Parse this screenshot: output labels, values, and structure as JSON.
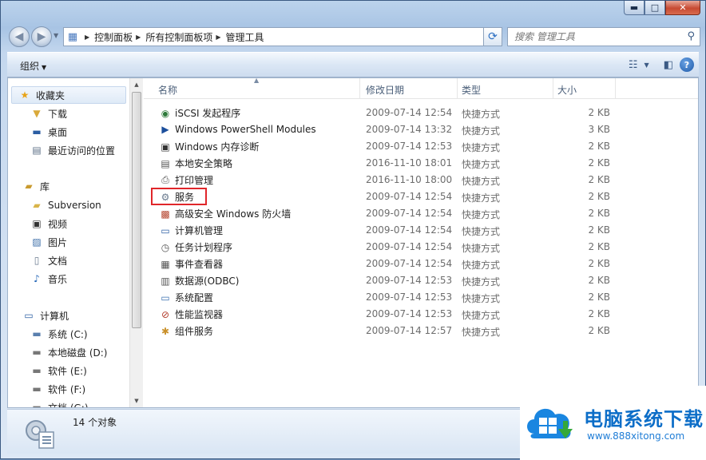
{
  "window": {
    "caption": {
      "minimize": "▬",
      "maximize": "□",
      "close": "✕"
    }
  },
  "addressbar": {
    "breadcrumbs": [
      "控制面板",
      "所有控制面板项",
      "管理工具"
    ]
  },
  "search": {
    "placeholder": "搜索 管理工具"
  },
  "toolbar": {
    "organize_label": "组织"
  },
  "nav": {
    "items": [
      {
        "label": "收藏夹",
        "icon": "star-icon"
      },
      {
        "label": "下载",
        "icon": "download-folder-icon"
      },
      {
        "label": "桌面",
        "icon": "desktop-icon"
      },
      {
        "label": "最近访问的位置",
        "icon": "recent-places-icon"
      },
      {
        "label": "库",
        "icon": "library-icon"
      },
      {
        "label": "Subversion",
        "icon": "folder-icon"
      },
      {
        "label": "视频",
        "icon": "video-icon"
      },
      {
        "label": "图片",
        "icon": "picture-icon"
      },
      {
        "label": "文档",
        "icon": "document-icon"
      },
      {
        "label": "音乐",
        "icon": "music-icon"
      },
      {
        "label": "计算机",
        "icon": "computer-icon"
      },
      {
        "label": "系统 (C:)",
        "icon": "system-drive-icon"
      },
      {
        "label": "本地磁盘 (D:)",
        "icon": "drive-icon"
      },
      {
        "label": "软件 (E:)",
        "icon": "drive-icon"
      },
      {
        "label": "软件 (F:)",
        "icon": "drive-icon"
      },
      {
        "label": "文档 (G:)",
        "icon": "drive-icon"
      }
    ]
  },
  "columns": {
    "name": "名称",
    "date": "修改日期",
    "type": "类型",
    "size": "大小"
  },
  "files": [
    {
      "name": "iSCSI 发起程序",
      "date": "2009-07-14 12:54",
      "type": "快捷方式",
      "size": "2 KB",
      "icon": "iscsi-icon"
    },
    {
      "name": "Windows PowerShell Modules",
      "date": "2009-07-14 13:32",
      "type": "快捷方式",
      "size": "3 KB",
      "icon": "powershell-icon"
    },
    {
      "name": "Windows 内存诊断",
      "date": "2009-07-14 12:53",
      "type": "快捷方式",
      "size": "2 KB",
      "icon": "memory-diagnostic-icon"
    },
    {
      "name": "本地安全策略",
      "date": "2016-11-10 18:01",
      "type": "快捷方式",
      "size": "2 KB",
      "icon": "security-policy-icon"
    },
    {
      "name": "打印管理",
      "date": "2016-11-10 18:00",
      "type": "快捷方式",
      "size": "2 KB",
      "icon": "print-management-icon"
    },
    {
      "name": "服务",
      "date": "2009-07-14 12:54",
      "type": "快捷方式",
      "size": "2 KB",
      "icon": "services-gear-icon"
    },
    {
      "name": "高级安全 Windows 防火墙",
      "date": "2009-07-14 12:54",
      "type": "快捷方式",
      "size": "2 KB",
      "icon": "firewall-icon"
    },
    {
      "name": "计算机管理",
      "date": "2009-07-14 12:54",
      "type": "快捷方式",
      "size": "2 KB",
      "icon": "computer-management-icon"
    },
    {
      "name": "任务计划程序",
      "date": "2009-07-14 12:54",
      "type": "快捷方式",
      "size": "2 KB",
      "icon": "task-scheduler-icon"
    },
    {
      "name": "事件查看器",
      "date": "2009-07-14 12:54",
      "type": "快捷方式",
      "size": "2 KB",
      "icon": "event-viewer-icon"
    },
    {
      "name": "数据源(ODBC)",
      "date": "2009-07-14 12:53",
      "type": "快捷方式",
      "size": "2 KB",
      "icon": "odbc-icon"
    },
    {
      "name": "系统配置",
      "date": "2009-07-14 12:53",
      "type": "快捷方式",
      "size": "2 KB",
      "icon": "system-config-icon"
    },
    {
      "name": "性能监视器",
      "date": "2009-07-14 12:53",
      "type": "快捷方式",
      "size": "2 KB",
      "icon": "performance-monitor-icon"
    },
    {
      "name": "组件服务",
      "date": "2009-07-14 12:57",
      "type": "快捷方式",
      "size": "2 KB",
      "icon": "component-services-icon"
    }
  ],
  "status": {
    "count": "14 个对象"
  },
  "watermark": {
    "title": "电脑系统下载",
    "url": "www.888xitong.com"
  },
  "colors": {
    "highlight_box": "#e0262a",
    "watermark_blue": "#0d6ec8"
  }
}
